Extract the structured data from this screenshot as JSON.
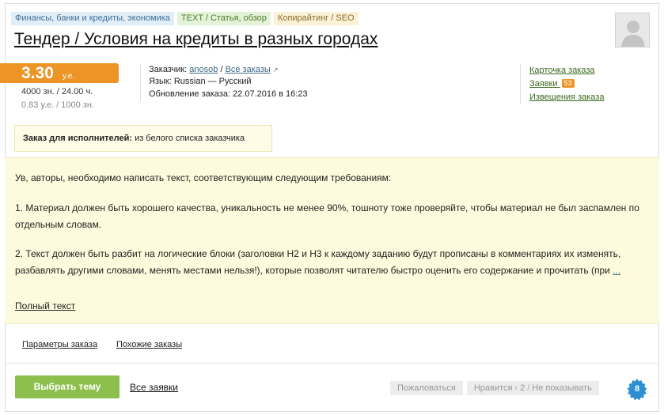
{
  "tags": [
    "Финансы, банки и кредиты, экономика",
    "TEXT / Статья, обзор",
    "Копирайтинг / SEO"
  ],
  "title": "Тендер / Условия на кредиты в разных городах",
  "price": {
    "amount": "3.30",
    "currency": "у.е.",
    "volume_time": "4000 зн. / 24.00 ч.",
    "rate": "0.83 у.е. / 1000 зн."
  },
  "meta": {
    "customer_label": "Заказчик:",
    "customer_name": "anosob",
    "sep": "/",
    "all_orders": "Все заказы",
    "language": "Язык: Russian — Русский",
    "updated": "Обновление заказа: 22.07.2016 в 16:23"
  },
  "links": {
    "card": "Карточка заказа",
    "bids": "Заявки",
    "bids_count": "53",
    "notices": "Извещения заказа"
  },
  "notice": {
    "label": "Заказ для исполнителей:",
    "value": "из белого списка заказчика"
  },
  "description": {
    "p1": "Ув, авторы, необходимо написать текст, соответствующим следующим требованиям:",
    "p2": "1. Материал должен быть хорошего качества, уникальность не менее 90%, тошноту тоже проверяйте, чтобы материал не был заспамлен по отдельным словам.",
    "p3": "2. Текст должен быть разбит на логические блоки (заголовки Н2 и Н3 к каждому заданию будут прописаны в комментариях их изменять, разбавлять другими словами, менять местами нельзя!), которые позволят читателю быстро оценить его содержание и прочитать (при",
    "more": "...",
    "full_text": "Полный текст"
  },
  "tabs": [
    "Параметры заказа",
    "Похожие заказы"
  ],
  "footer": {
    "choose": "Выбрать тему",
    "all_bids": "Все заявки",
    "complain": "Пожаловаться",
    "like": "Нравится",
    "like_count": "2",
    "hide": "Не показывать",
    "badge": "8"
  },
  "colors": {
    "accent_orange": "#ec9425",
    "green_button": "#8cbf4c",
    "badge_blue": "#2c8fd1",
    "desc_bg": "#fdfbdd"
  },
  "icons": [
    "user-avatar-icon",
    "external-link-icon",
    "gear-badge-icon"
  ]
}
